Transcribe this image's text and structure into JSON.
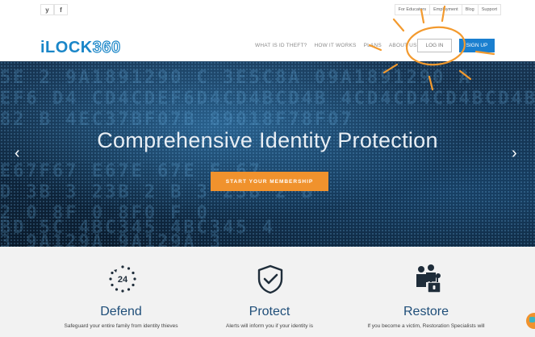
{
  "utility_bar": {
    "social": [
      "y",
      "f"
    ],
    "links": [
      "For Educators",
      "Employment",
      "Blog",
      "Support"
    ]
  },
  "header": {
    "logo_text": "iLOCK",
    "logo_num": "360",
    "nav": [
      "WHAT IS ID THEFT?",
      "HOW IT WORKS",
      "PLANS",
      "ABOUT US"
    ],
    "login_label": "LOG IN",
    "signup_label": "SIGN UP"
  },
  "hero": {
    "title": "Comprehensive Identity Protection",
    "cta_label": "START YOUR MEMBERSHIP",
    "prev_arrow": "‹",
    "next_arrow": "›"
  },
  "features": [
    {
      "icon": "24-hour-icon",
      "icon_text": "24",
      "title": "Defend",
      "text": "Safeguard your entire family from identity thieves"
    },
    {
      "icon": "shield-check-icon",
      "title": "Protect",
      "text": "Alerts will inform you if your identity is"
    },
    {
      "icon": "family-lock-icon",
      "title": "Restore",
      "text": "If you become a victim, Restoration Specialists will"
    }
  ],
  "colors": {
    "brand_blue": "#1a86c8",
    "cta_orange": "#f0922d",
    "feature_title": "#1f4e79",
    "annotation_orange": "#f39a2e"
  }
}
